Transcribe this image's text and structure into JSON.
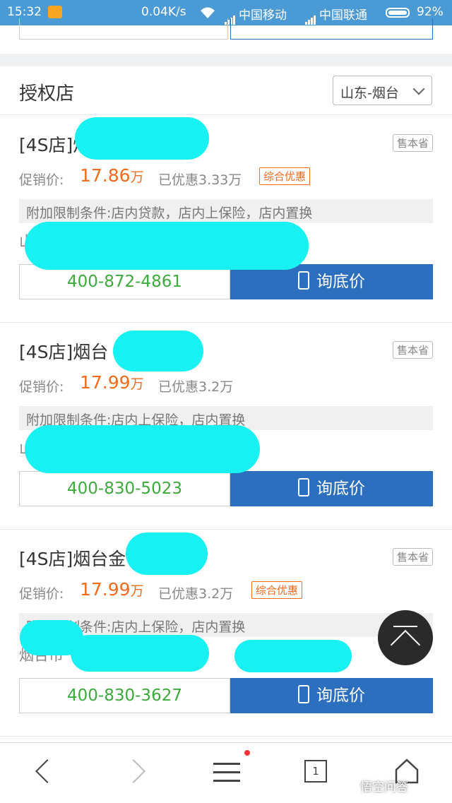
{
  "status_bar": {
    "time": "15:32",
    "speed": "0.04K/s",
    "carrier1": "中国移动",
    "carrier2": "中国联通",
    "battery": "92%"
  },
  "section": {
    "title": "授权店",
    "region": "山东-烟台"
  },
  "dealers": [
    {
      "name": "[4S店]烟",
      "badge": "售本省",
      "price_label": "促销价:",
      "price": "17.86",
      "unit": "万",
      "saved": "已优惠3.33万",
      "tag": "综合优惠",
      "conditions": "附加限制条件:店内贷款，店内上保险，店内置换",
      "address": "山",
      "phone": "400-872-4861",
      "ask": "询底价"
    },
    {
      "name": "[4S店]烟台",
      "badge": "售本省",
      "price_label": "促销价:",
      "price": "17.99",
      "unit": "万",
      "saved": "已优惠3.2万",
      "tag": "",
      "conditions": "附加限制条件:店内上保险，店内置换",
      "address": "山                                              号",
      "phone": "400-830-5023",
      "ask": "询底价"
    },
    {
      "name": "[4S店]烟台金",
      "badge": "售本省",
      "price_label": "促销价:",
      "price": "17.99",
      "unit": "万",
      "saved": "已优惠3.2万",
      "tag": "综合优惠",
      "conditions": "附加限制条件:店内上保险，店内置换",
      "address": "烟台市                              号 (                              )",
      "phone": "400-830-3627",
      "ask": "询底价"
    }
  ],
  "nav": {
    "tab_count": "1"
  },
  "watermark": "悟空问答",
  "colors": {
    "accent": "#2c6fbf",
    "price": "#f26b1d",
    "phone": "#3caa3c",
    "redaction": "#17f1f1"
  }
}
